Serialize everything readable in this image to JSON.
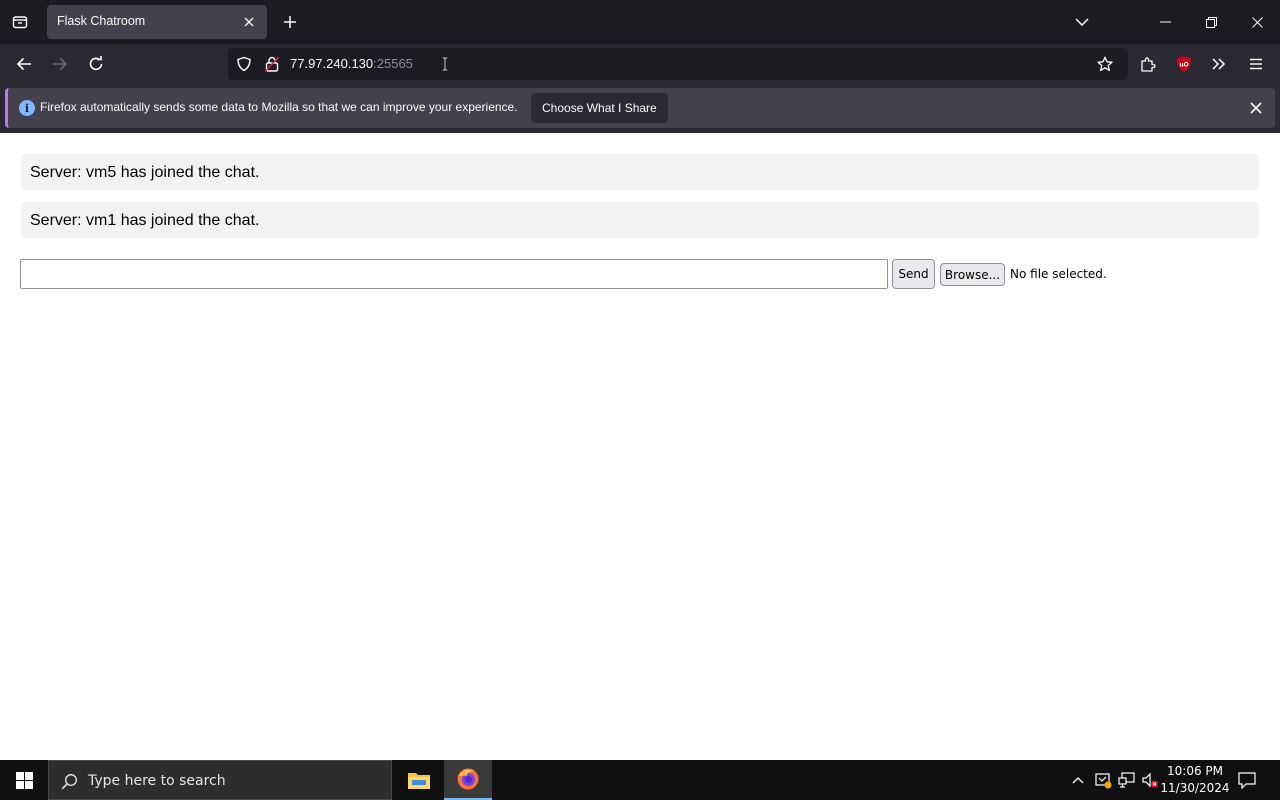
{
  "browser": {
    "tab": {
      "title": "Flask Chatroom"
    },
    "url": {
      "host": "77.97.240.130",
      "port": ":25565"
    },
    "icons": [
      "list-all-tabs-icon",
      "close-icon",
      "plus-icon",
      "chevron-down-icon",
      "minimize-icon",
      "restore-icon",
      "close-icon",
      "back-arrow-icon",
      "forward-arrow-icon",
      "reload-icon",
      "shield-icon",
      "lock-icon",
      "text-cursor-icon",
      "star-icon",
      "puzzle-icon",
      "ublock-icon",
      "chevron-double-right-icon",
      "hamburger-menu-icon",
      "info-icon"
    ],
    "notification": {
      "message": "Firefox automatically sends some data to Mozilla so that we can improve your experience.",
      "button_label": "Choose What I Share",
      "info_glyph": "i"
    },
    "colors": {
      "toolbar": "#2b2a33",
      "tabstrip": "#1c1b22",
      "accent": "#b57cf1",
      "ublock": "#d0021b"
    }
  },
  "chat": {
    "messages": [
      "Server: vm5 has joined the chat.",
      "Server: vm1 has joined the chat."
    ],
    "input_value": "",
    "send_label": "Send",
    "browse_label": "Browse...",
    "file_status": "No file selected."
  },
  "taskbar": {
    "search_placeholder": "Type here to search",
    "clock_time": "10:06 PM",
    "clock_date": "11/30/2024",
    "icons": [
      "windows-start-icon",
      "search-icon",
      "file-explorer-icon",
      "firefox-icon",
      "chevron-up-icon",
      "security-alert-icon",
      "network-icon",
      "volume-muted-icon",
      "notification-center-icon"
    ]
  }
}
